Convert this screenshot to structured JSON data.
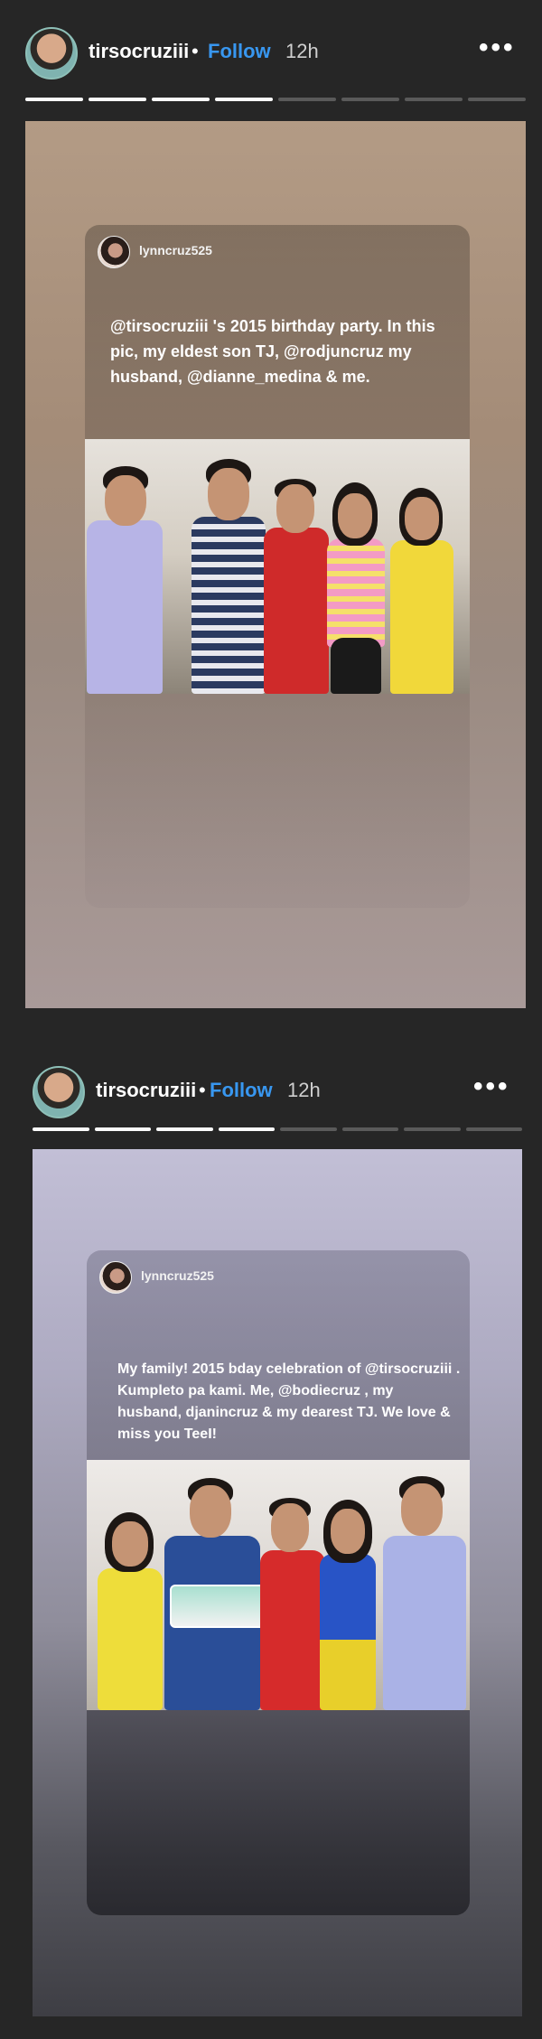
{
  "stories": [
    {
      "header": {
        "username": "tirsocruziii",
        "separator": "•",
        "follow_label": "Follow",
        "time": "12h",
        "more_label": "•••"
      },
      "progress": {
        "segments": 8,
        "completed": 4
      },
      "card": {
        "username": "lynncruz525",
        "caption": "@tirsocruziii 's 2015 birthday party. In this pic, my eldest son TJ, @rodjuncruz my husband, @dianne_medina  & me."
      }
    },
    {
      "header": {
        "username": "tirsocruziii",
        "separator": "•",
        "follow_label": "Follow",
        "time": "12h",
        "more_label": "•••"
      },
      "progress": {
        "segments": 8,
        "completed": 4
      },
      "card": {
        "username": "lynncruz525",
        "caption": "My family! 2015 bday celebration of @tirsocruziii . Kumpleto pa kami. Me, @bodiecruz , my husband, djanincruz & my dearest TJ. We love & miss you TeeI!"
      }
    }
  ]
}
